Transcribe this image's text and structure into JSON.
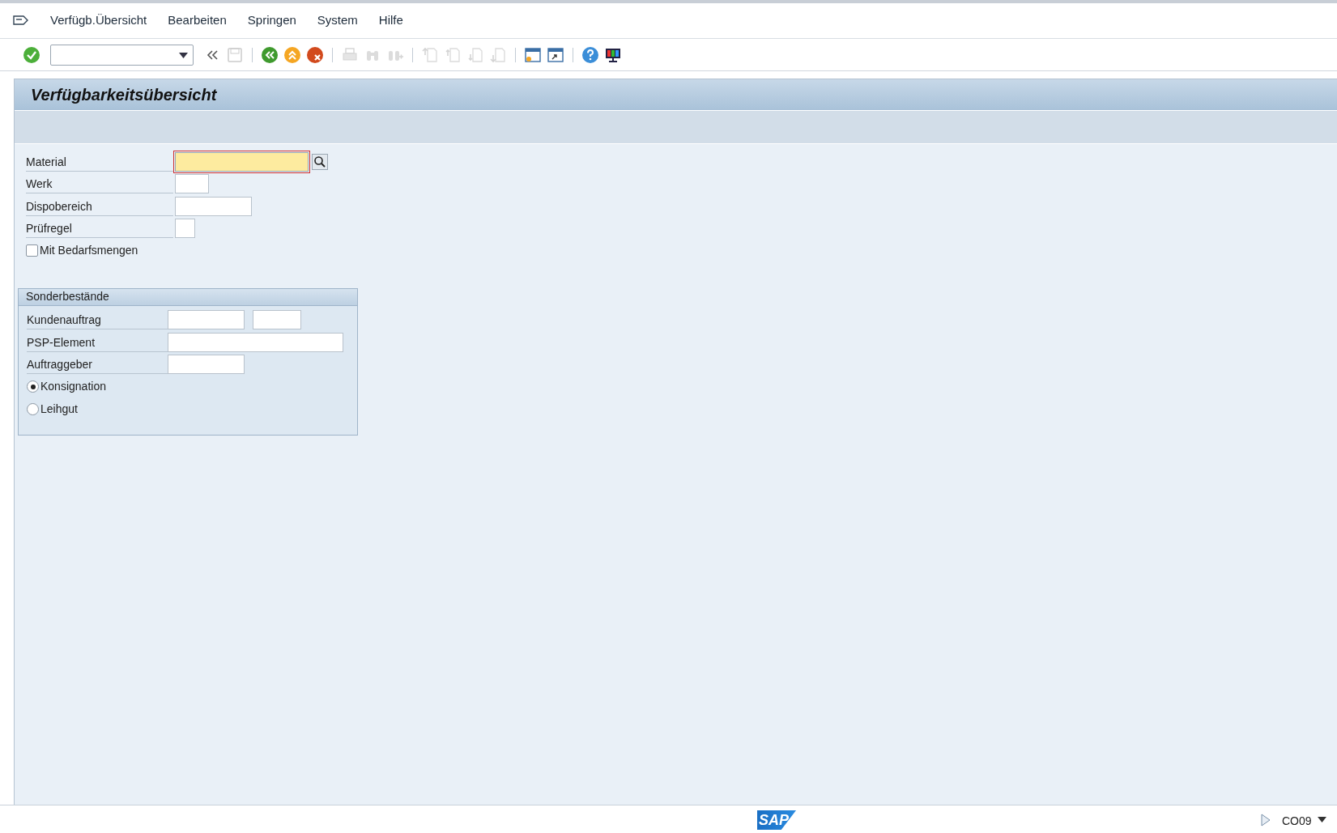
{
  "menu": [
    {
      "label": "Verfügb.Übersicht"
    },
    {
      "label": "Bearbeiten"
    },
    {
      "label": "Springen"
    },
    {
      "label": "System"
    },
    {
      "label": "Hilfe"
    }
  ],
  "toolbar": [
    {
      "kind": "enter",
      "disabled": false
    },
    {
      "kind": "command"
    },
    {
      "kind": "collapse",
      "disabled": false
    },
    {
      "kind": "save",
      "disabled": true
    },
    {
      "kind": "sep"
    },
    {
      "kind": "back",
      "disabled": false
    },
    {
      "kind": "exit",
      "disabled": false
    },
    {
      "kind": "cancel",
      "disabled": false
    },
    {
      "kind": "sep"
    },
    {
      "kind": "print",
      "disabled": true
    },
    {
      "kind": "find",
      "disabled": true
    },
    {
      "kind": "find-next",
      "disabled": true
    },
    {
      "kind": "sep"
    },
    {
      "kind": "first",
      "disabled": true
    },
    {
      "kind": "prev",
      "disabled": true
    },
    {
      "kind": "next",
      "disabled": true
    },
    {
      "kind": "last",
      "disabled": true
    },
    {
      "kind": "sep"
    },
    {
      "kind": "new-session",
      "disabled": false
    },
    {
      "kind": "shortcut",
      "disabled": false
    },
    {
      "kind": "sep"
    },
    {
      "kind": "help",
      "disabled": false
    },
    {
      "kind": "layout",
      "disabled": false
    }
  ],
  "title": "Verfügbarkeitsübersicht",
  "fields": [
    {
      "kind": "text",
      "label": "Material",
      "focused": true,
      "search_help": true
    },
    {
      "kind": "text",
      "label": "Werk",
      "focused": false,
      "search_help": false
    },
    {
      "kind": "text",
      "label": "Dispobereich",
      "focused": false,
      "search_help": false
    },
    {
      "kind": "text",
      "label": "Prüfregel",
      "focused": false,
      "search_help": false
    },
    {
      "kind": "checkbox",
      "label": "Mit Bedarfsmengen",
      "checked": false
    }
  ],
  "group": {
    "title": "Sonderbestände",
    "fields": [
      {
        "kind": "text2",
        "label": "Kundenauftrag"
      },
      {
        "kind": "text",
        "label": "PSP-Element"
      },
      {
        "kind": "text",
        "label": "Auftraggeber"
      },
      {
        "kind": "radio",
        "label": "Konsignation",
        "selected": true
      },
      {
        "kind": "radio",
        "label": "Leihgut",
        "selected": false
      }
    ]
  },
  "status_bar": {
    "logo": "SAP",
    "transaction": "CO09"
  }
}
